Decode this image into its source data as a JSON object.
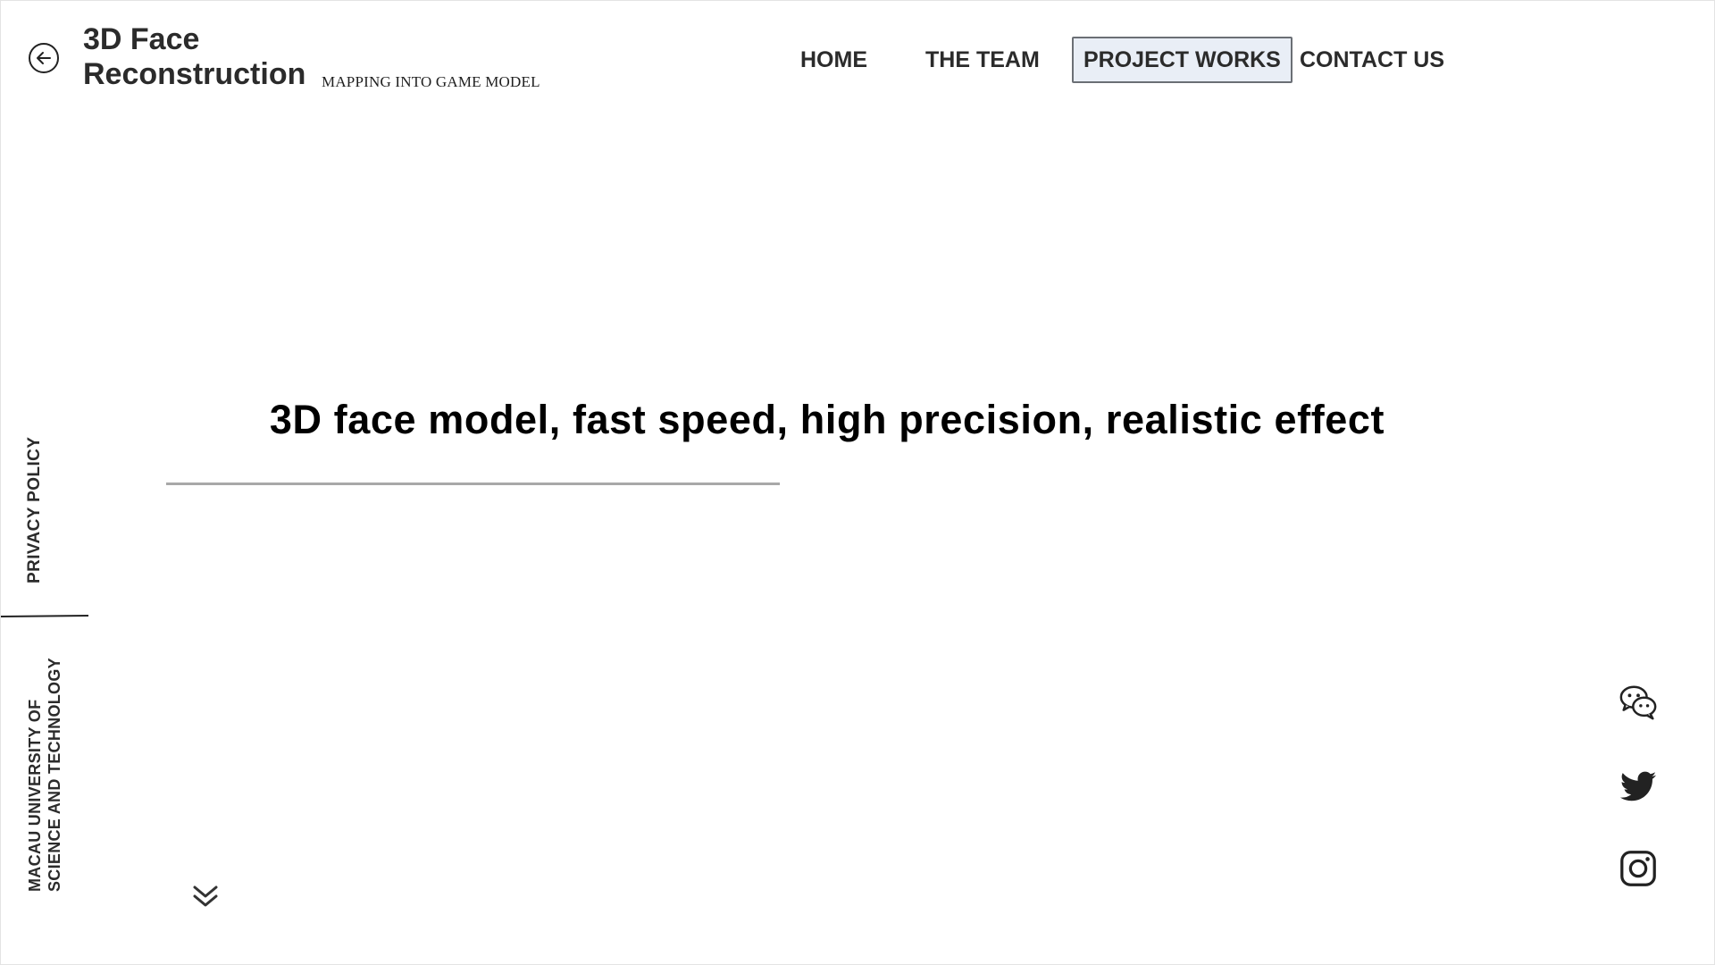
{
  "header": {
    "back_icon": "circle-arrow-left-icon",
    "brand_line1": "3D Face",
    "brand_line2": "Reconstruction",
    "subtitle": "MAPPING INTO GAME MODEL"
  },
  "nav": {
    "items": [
      {
        "label": "HOME",
        "active": false
      },
      {
        "label": "THE TEAM",
        "active": false
      },
      {
        "label": "PROJECT WORKS",
        "active": true
      },
      {
        "label": "CONTACT US",
        "active": false
      }
    ]
  },
  "hero": {
    "title": "3D face model, fast speed, high precision, realistic effect"
  },
  "sidebar": {
    "privacy_label": "PRIVACY POLICY",
    "university_line1": "MACAU UNIVERSITY OF",
    "university_line2": "SCIENCE AND TECHNOLOGY"
  },
  "scroll": {
    "icon": "double-chevron-down-icon"
  },
  "social": {
    "icons": [
      "wechat-icon",
      "twitter-icon",
      "instagram-icon"
    ]
  },
  "colors": {
    "text": "#2b2b2b",
    "active_nav_bg": "#e9eef6",
    "active_nav_border": "#6b6f75",
    "rule": "#a8a8a8"
  }
}
